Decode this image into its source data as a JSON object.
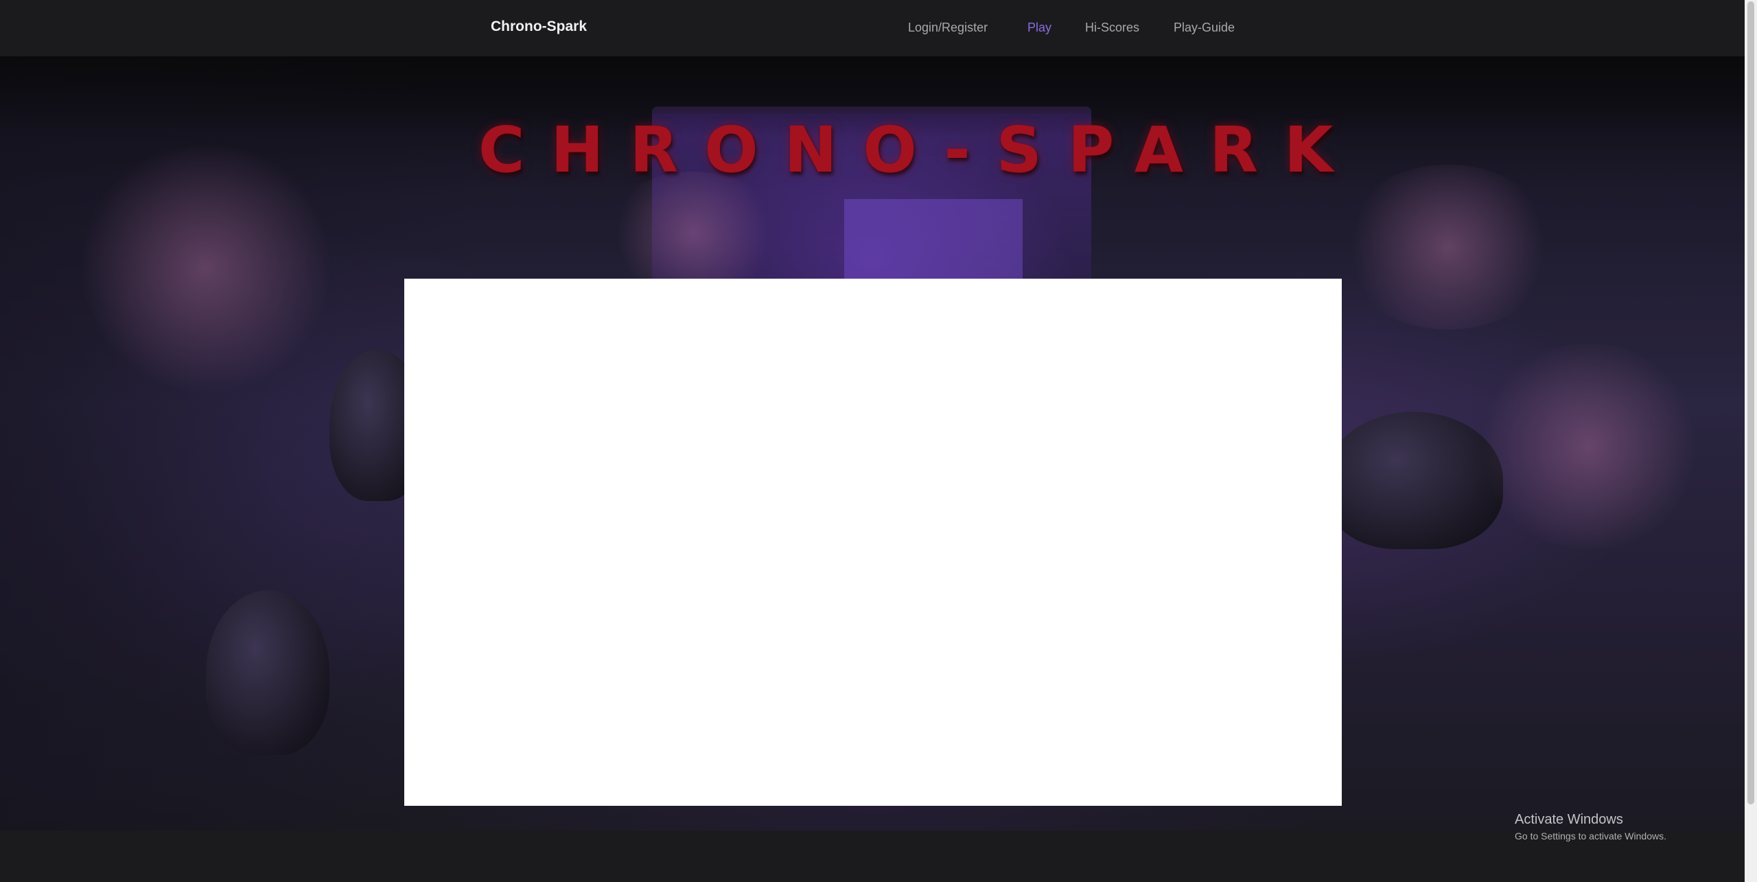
{
  "navbar": {
    "brand": "Chrono-Spark",
    "items": [
      {
        "label": "Login/Register",
        "active": false
      },
      {
        "label": "Play",
        "active": true
      },
      {
        "label": "Hi-Scores",
        "active": false
      },
      {
        "label": "Play-Guide",
        "active": false
      }
    ],
    "active_color": "#8c6be0"
  },
  "hero": {
    "logo_text": "CHRONO-SPARK",
    "logo_color": "#a4121f"
  },
  "game": {
    "canvas_color": "#ffffff"
  },
  "watermark": {
    "title": "Activate Windows",
    "subtitle": "Go to Settings to activate Windows."
  }
}
